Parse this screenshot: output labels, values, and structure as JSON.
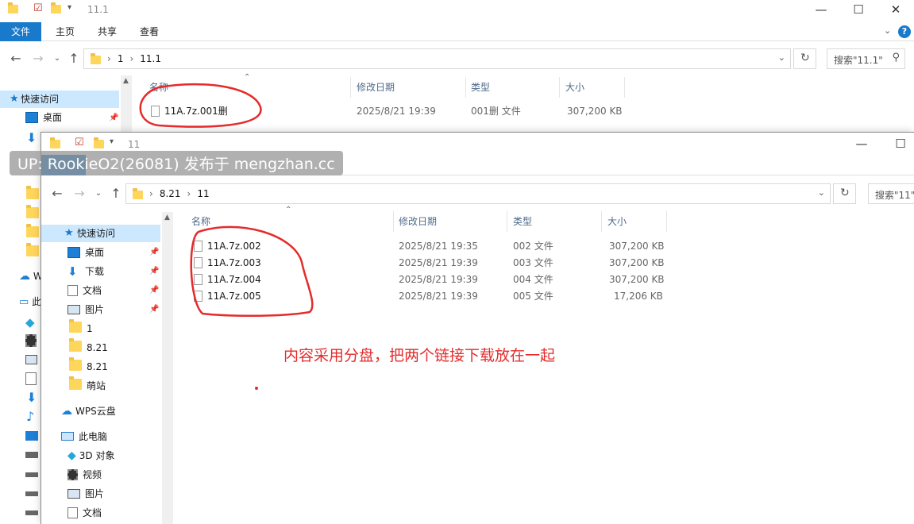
{
  "back_window": {
    "title": "11.1",
    "ribbon_tabs": [
      "文件",
      "主页",
      "共享",
      "查看"
    ],
    "breadcrumbs": [
      "1",
      "11.1"
    ],
    "search_placeholder": "搜索\"11.1\"",
    "columns": [
      "名称",
      "修改日期",
      "类型",
      "大小"
    ],
    "files": [
      {
        "name": "11A.7z.001删",
        "date": "2025/8/21 19:39",
        "type": "001删 文件",
        "size": "307,200 KB"
      }
    ],
    "nav_quick_access": "快速访问",
    "nav_desktop": "桌面",
    "nav_partial": [
      "W",
      "此"
    ]
  },
  "front_window": {
    "title": "11",
    "breadcrumbs": [
      "8.21",
      "11"
    ],
    "search_placeholder": "搜索\"11\"",
    "columns": [
      "名称",
      "修改日期",
      "类型",
      "大小"
    ],
    "files": [
      {
        "name": "11A.7z.002",
        "date": "2025/8/21 19:35",
        "type": "002 文件",
        "size": "307,200 KB"
      },
      {
        "name": "11A.7z.003",
        "date": "2025/8/21 19:39",
        "type": "003 文件",
        "size": "307,200 KB"
      },
      {
        "name": "11A.7z.004",
        "date": "2025/8/21 19:39",
        "type": "004 文件",
        "size": "307,200 KB"
      },
      {
        "name": "11A.7z.005",
        "date": "2025/8/21 19:39",
        "type": "005 文件",
        "size": "17,206 KB"
      }
    ],
    "nav": {
      "quick_access": "快速访问",
      "desktop": "桌面",
      "downloads": "下载",
      "documents": "文档",
      "pictures": "图片",
      "folder_1": "1",
      "folder_821a": "8.21",
      "folder_821b": "8.21",
      "folder_mengzhan": "萌站",
      "wps_cloud": "WPS云盘",
      "this_pc": "此电脑",
      "objects_3d": "3D 对象",
      "videos": "视频",
      "pictures2": "图片",
      "documents2": "文档"
    }
  },
  "overlay_watermark": "UP: RookieO2(26081) 发布于 mengzhan.cc",
  "annotation_text": "内容采用分盘，把两个链接下载放在一起",
  "colors": {
    "accent": "#1979ca",
    "annotation": "#e52b2b",
    "selection": "#cce8ff",
    "folder": "#ffd65c"
  }
}
